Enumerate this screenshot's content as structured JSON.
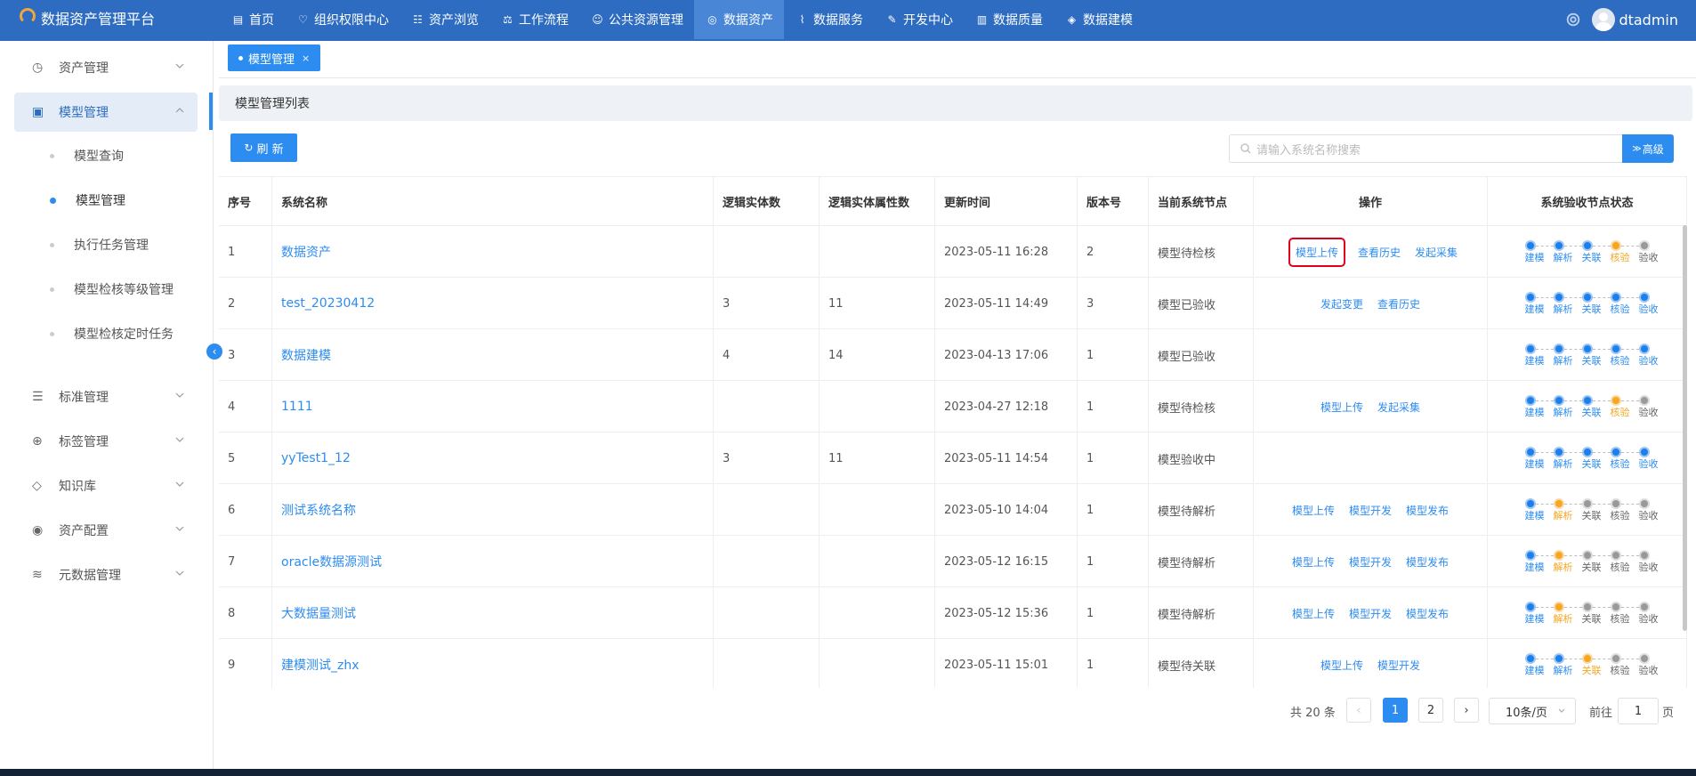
{
  "app": {
    "title": "数据资产管理平台"
  },
  "nav": [
    {
      "label": "首页",
      "icon": "document-icon"
    },
    {
      "label": "组织权限中心",
      "icon": "shield-heart-icon"
    },
    {
      "label": "资产浏览",
      "icon": "list-icon"
    },
    {
      "label": "工作流程",
      "icon": "scale-icon"
    },
    {
      "label": "公共资源管理",
      "icon": "people-icon"
    },
    {
      "label": "数据资产",
      "icon": "chat-icon",
      "active": true
    },
    {
      "label": "数据服务",
      "icon": "pulse-icon"
    },
    {
      "label": "开发中心",
      "icon": "edit-icon"
    },
    {
      "label": "数据质量",
      "icon": "chart-icon"
    },
    {
      "label": "数据建模",
      "icon": "layers-icon"
    }
  ],
  "user": {
    "name": "dtadmin"
  },
  "sidebar": {
    "menu": [
      {
        "label": "资产管理",
        "icon": "clock-icon"
      },
      {
        "label": "模型管理",
        "icon": "chart-box-icon",
        "open": true
      },
      {
        "label": "标准管理",
        "icon": "doc-lines-icon"
      },
      {
        "label": "标签管理",
        "icon": "plus-circle-icon"
      },
      {
        "label": "知识库",
        "icon": "tag-icon"
      },
      {
        "label": "资产配置",
        "icon": "target-icon"
      },
      {
        "label": "元数据管理",
        "icon": "stack-icon"
      }
    ],
    "submenu": [
      {
        "label": "模型查询"
      },
      {
        "label": "模型管理",
        "active": true
      },
      {
        "label": "执行任务管理"
      },
      {
        "label": "模型检核等级管理"
      },
      {
        "label": "模型检核定时任务"
      }
    ]
  },
  "tab": {
    "label": "模型管理",
    "close": "×"
  },
  "panel": {
    "title": "模型管理列表"
  },
  "toolbar": {
    "refresh": "刷 新",
    "search_placeholder": "请输入系统名称搜索",
    "advanced": "高级"
  },
  "table": {
    "headers": [
      "序号",
      "系统名称",
      "逻辑实体数",
      "逻辑实体属性数",
      "更新时间",
      "版本号",
      "当前系统节点",
      "操作",
      "系统验收节点状态"
    ],
    "stage_labels": [
      "建模",
      "解析",
      "关联",
      "核验",
      "验收"
    ],
    "rows": [
      {
        "no": "1",
        "name": "数据资产",
        "entities": "",
        "attrs": "",
        "time": "2023-05-11 16:28",
        "version": "2",
        "node": "模型待检核",
        "ops": [
          "模型上传",
          "查看历史",
          "发起采集"
        ],
        "highlight": 0,
        "stages": [
          "done",
          "done",
          "done",
          "cur",
          "todo"
        ]
      },
      {
        "no": "2",
        "name": "test_20230412",
        "entities": "3",
        "attrs": "11",
        "time": "2023-05-11 14:49",
        "version": "3",
        "node": "模型已验收",
        "ops": [
          "发起变更",
          "查看历史"
        ],
        "stages": [
          "done",
          "done",
          "done",
          "done",
          "done"
        ]
      },
      {
        "no": "3",
        "name": "数据建模",
        "entities": "4",
        "attrs": "14",
        "time": "2023-04-13 17:06",
        "version": "1",
        "node": "模型已验收",
        "ops": [],
        "stages": [
          "done",
          "done",
          "done",
          "done",
          "done"
        ]
      },
      {
        "no": "4",
        "name": "1111",
        "entities": "",
        "attrs": "",
        "time": "2023-04-27 12:18",
        "version": "1",
        "node": "模型待检核",
        "ops": [
          "模型上传",
          "发起采集"
        ],
        "stages": [
          "done",
          "done",
          "done",
          "cur",
          "todo"
        ]
      },
      {
        "no": "5",
        "name": "yyTest1_12",
        "entities": "3",
        "attrs": "11",
        "time": "2023-05-11 14:54",
        "version": "1",
        "node": "模型验收中",
        "ops": [],
        "stages": [
          "done",
          "done",
          "done",
          "done",
          "done"
        ]
      },
      {
        "no": "6",
        "name": "测试系统名称",
        "entities": "",
        "attrs": "",
        "time": "2023-05-10 14:04",
        "version": "1",
        "node": "模型待解析",
        "ops": [
          "模型上传",
          "模型开发",
          "模型发布"
        ],
        "stages": [
          "done",
          "cur",
          "todo",
          "todo",
          "todo"
        ]
      },
      {
        "no": "7",
        "name": "oracle数据源测试",
        "entities": "",
        "attrs": "",
        "time": "2023-05-12 16:15",
        "version": "1",
        "node": "模型待解析",
        "ops": [
          "模型上传",
          "模型开发",
          "模型发布"
        ],
        "stages": [
          "done",
          "cur",
          "todo",
          "todo",
          "todo"
        ]
      },
      {
        "no": "8",
        "name": "大数据量测试",
        "entities": "",
        "attrs": "",
        "time": "2023-05-12 15:36",
        "version": "1",
        "node": "模型待解析",
        "ops": [
          "模型上传",
          "模型开发",
          "模型发布"
        ],
        "stages": [
          "done",
          "cur",
          "todo",
          "todo",
          "todo"
        ]
      },
      {
        "no": "9",
        "name": "建模测试_zhx",
        "entities": "",
        "attrs": "",
        "time": "2023-05-11 15:01",
        "version": "1",
        "node": "模型待关联",
        "ops": [
          "模型上传",
          "模型开发"
        ],
        "stages": [
          "done",
          "done",
          "cur",
          "todo",
          "todo"
        ]
      }
    ]
  },
  "pagination": {
    "total": "共 20 条",
    "prev": "‹",
    "pages": [
      "1",
      "2"
    ],
    "current": "1",
    "next": "›",
    "page_size": "10条/页",
    "goto_label": "前往",
    "goto_value": "1",
    "page_suffix": "页"
  },
  "colors": {
    "topbar": "#2d6cc0",
    "primary": "#2d8cf0",
    "warning": "#f5a623",
    "highlight": "#e0001a"
  }
}
